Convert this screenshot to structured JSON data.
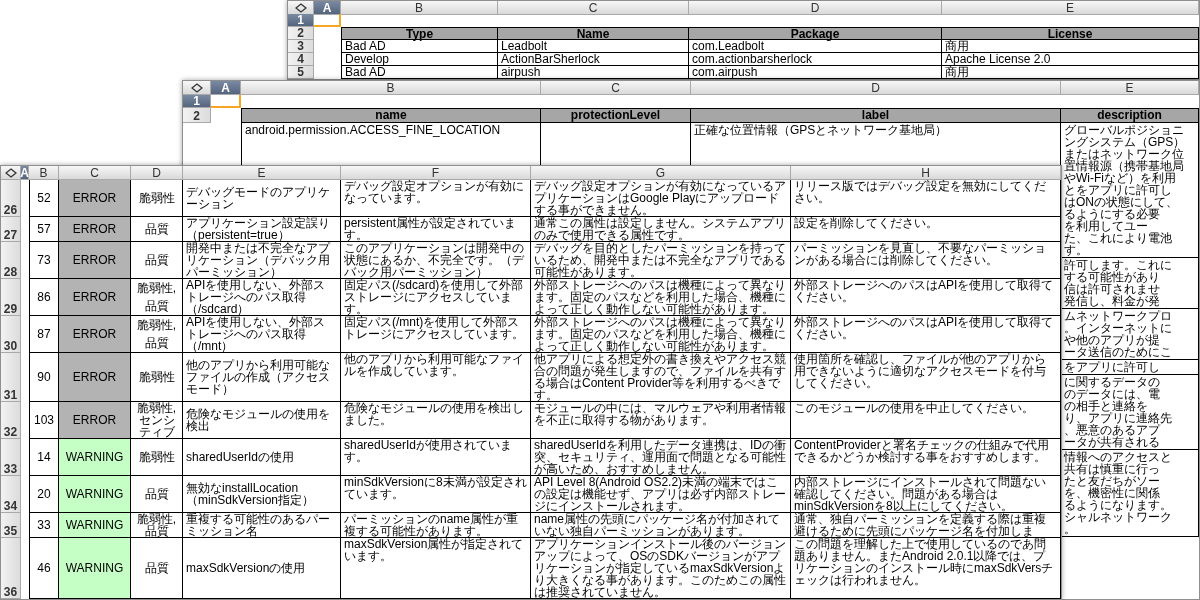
{
  "back_sheet": {
    "columns": [
      {
        "label": "A",
        "selected": true
      },
      {
        "label": "B",
        "selected": false
      },
      {
        "label": "C",
        "selected": false
      },
      {
        "label": "D",
        "selected": false
      },
      {
        "label": "E",
        "selected": false
      }
    ],
    "row_numbers": [
      {
        "label": "1",
        "selected": true
      },
      {
        "label": "2",
        "selected": false
      },
      {
        "label": "3",
        "selected": false
      },
      {
        "label": "4",
        "selected": false
      },
      {
        "label": "5",
        "selected": false
      }
    ],
    "header": [
      "Type",
      "Name",
      "Package",
      "License"
    ],
    "rows": [
      [
        "Bad AD",
        "Leadbolt",
        "com.Leadbolt",
        "商用"
      ],
      [
        "Develop",
        "ActionBarSherlock",
        "com.actionbarsherlock",
        "Apache License 2.0"
      ],
      [
        "Bad AD",
        "airpush",
        "com.airpush",
        "商用"
      ]
    ]
  },
  "middle_sheet": {
    "columns": [
      {
        "label": "A",
        "selected": true
      },
      {
        "label": "B",
        "selected": false
      },
      {
        "label": "C",
        "selected": false
      },
      {
        "label": "D",
        "selected": false
      },
      {
        "label": "E",
        "selected": false
      }
    ],
    "row_numbers": [
      {
        "label": "1",
        "selected": true
      },
      {
        "label": "2",
        "selected": false
      }
    ],
    "header": [
      "name",
      "protectionLevel",
      "label",
      "description"
    ],
    "rows": [
      {
        "column_b": "android.permission.ACCESS_FINE_LOCATION",
        "column_d": "正確な位置情報（GPSとネットワーク基地局）",
        "column_e": [
          "グローバルポジショニングシステム（GPS）またはネットワーク位置情報源（携帯基地局やWi-Fiなど）を利用",
          "とをアプリに許可し",
          "はONの状態にして、",
          "るようにする必要",
          "を利用してユー",
          "た、これにより電池",
          "す。"
        ]
      },
      {
        "column_e": [
          "許可します。これに",
          "する可能性があり",
          "信は許可されませ",
          "発信し、料金が発"
        ]
      },
      {
        "column_e": [
          "ムネットワークプロ",
          "。インターネットに",
          "や他のアプリが提",
          "ータ送信のためにこ"
        ]
      },
      {
        "column_e": [
          "をアプリに許可し"
        ]
      },
      {
        "column_e": [
          "に関するデータの",
          "のデータには、電",
          "の相手と連絡を",
          "り、アプリに連絡先",
          "、悪意のあるアプ",
          "ータが共有される"
        ]
      },
      {
        "column_e": [
          "情報へのアクセスと",
          "共有は慎重に行っ",
          "たと友だちがソー",
          "を、機密性に関係",
          "るようになります。",
          "シャルネットワーク",
          "。"
        ]
      }
    ]
  },
  "front_sheet": {
    "columns": [
      {
        "label": "A",
        "selected": true
      },
      {
        "label": "B",
        "selected": false
      },
      {
        "label": "C",
        "selected": false
      },
      {
        "label": "D",
        "selected": false
      },
      {
        "label": "E",
        "selected": false
      },
      {
        "label": "F",
        "selected": false
      },
      {
        "label": "G",
        "selected": false
      },
      {
        "label": "H",
        "selected": false
      }
    ],
    "rows": [
      {
        "number": "26",
        "column_b": "52",
        "column_c": "ERROR",
        "color": "#b3b3b3",
        "column_d": [
          "脆弱性"
        ],
        "column_e": "デバッグモードのアプリケーション",
        "column_f": "デバッグ設定オプションが有効になっています。",
        "column_g": "デバッグ設定オプションが有効になっているアプリケーションはGoogle Playにアップロードする事ができません。",
        "column_h": "リリース版ではデバッグ設定を無効にしてください。"
      },
      {
        "number": "27",
        "column_b": "57",
        "column_c": "ERROR",
        "color": "#b3b3b3",
        "column_d": [
          "品質"
        ],
        "column_e": "アプリケーション設定誤り（persistent=true）",
        "column_f": "persistent属性が設定されています。",
        "column_g": "通常この属性は設定しません。システムアプリのみで使用できる属性です。",
        "column_h": "設定を削除してください。"
      },
      {
        "number": "28",
        "column_b": "73",
        "column_c": "ERROR",
        "color": "#b3b3b3",
        "column_d": [
          "品質"
        ],
        "column_e": "開発中または不完全なアプリケーション（デバック用パーミッション）",
        "column_f": "このアプリケーションは開発中の状態にあるか、不完全です。（デバック用パーミッション）",
        "column_g": "デバッグを目的としたパーミッションを持っているため、開発中または不完全なアプリである可能性があります。",
        "column_h": "パーミッションを見直し、不要なパーミッションがある場合には削除してください。"
      },
      {
        "number": "29",
        "column_b": "86",
        "column_c": "ERROR",
        "color": "#b3b3b3",
        "column_d": [
          "脆弱性,",
          "品質"
        ],
        "column_e": "APIを使用しない、外部ストレージへのパス取得（/sdcard）",
        "column_f": "固定パス(/sdcard)を使用して外部ストレージにアクセスしています。",
        "column_g": "外部ストレージへのパスは機種によって異なります。固定のパスなどを利用した場合、機種によって正しく動作しない可能性があります。",
        "column_h": "外部ストレージへのパスはAPIを使用して取得てください。"
      },
      {
        "number": "30",
        "column_b": "87",
        "column_c": "ERROR",
        "color": "#b3b3b3",
        "column_d": [
          "脆弱性,",
          "品質"
        ],
        "column_e": "APIを使用しない、外部ストレージへのパス取得（/mnt）",
        "column_f": "固定パス(/mnt)を使用して外部ストレージにアクセスしています。",
        "column_g": "外部ストレージへのパスは機種によって異なります。固定のパスなどを利用した場合、機種によって正しく動作しない可能性があります。",
        "column_h": "外部ストレージへのパスはAPIを使用して取得てください。"
      },
      {
        "number": "31",
        "column_b": "90",
        "column_c": "ERROR",
        "color": "#b3b3b3",
        "column_d": [
          "脆弱性"
        ],
        "column_e": "他のアプリから利用可能なファイルの作成（アクセスモード）",
        "column_f": "他のアプリから利用可能なファイルを作成しています。",
        "column_g": "他アプリによる想定外の書き換えやアクセス競合の問題が発生しますので、ファイルを共有する場合はContent Provider等を利用するべきです。",
        "column_h": "使用箇所を確認し、ファイルが他のアプリから用できないように適切なアクセスモードを付与してください。"
      },
      {
        "number": "32",
        "column_b": "103",
        "column_c": "ERROR",
        "color": "#b3b3b3",
        "column_d": [
          "脆弱性,",
          "センシティブ"
        ],
        "column_e": "危険なモジュールの使用を検出",
        "column_f": "危険なモジュールの使用を検出しました。",
        "column_g": "モジュールの中には、マルウェアや利用者情報を不正に取得する物があります。",
        "column_h": "このモジュールの使用を中止してください。"
      },
      {
        "number": "33",
        "column_b": "14",
        "column_c": "WARNING",
        "color": "#c6ffc6",
        "column_d": [
          "脆弱性"
        ],
        "column_e": "sharedUserIdの使用",
        "column_f": "sharedUserIdが使用されています。",
        "column_g": "sharedUserIdを利用したデータ連携は、IDの衝突、セキュリティ、運用面で問題となる可能性が高いため、おすすめしません。",
        "column_h": "ContentProviderと署名チェックの仕組みで代用できるかどうか検討する事をおすすめします。"
      },
      {
        "number": "34",
        "column_b": "20",
        "column_c": "WARNING",
        "color": "#c6ffc6",
        "column_d": [
          "品質"
        ],
        "column_e": "無効なinstallLocation（minSdkVersion指定）",
        "column_f": "minSdkVersionに8未満が設定されています。",
        "column_g": "API Level 8(Android OS2.2)未満の端末ではこの設定は機能せず、アプリは必ず内部ストレージにインストールされます。",
        "column_h": "内部ストレージにインストールされて問題ない確認してください。問題がある場合はminSdkVersionを8以上にしてください。"
      },
      {
        "number": "35",
        "column_b": "33",
        "column_c": "WARNING",
        "color": "#c6ffc6",
        "column_d": [
          "脆弱性,",
          "品質"
        ],
        "column_e": "重複する可能性のあるパーミッション名",
        "column_f": "パーミッションのname属性が重複する可能性があります。",
        "column_g": "name属性の先頭にパッケージ名が付加されていない独自パーミッションがあります。",
        "column_h": "通常、独自パーミッションを定義する際は重複避けるために先頭にパッケージ名を付加しま"
      },
      {
        "number": "36",
        "column_b": "46",
        "column_c": "WARNING",
        "color": "#c6ffc6",
        "column_d": [
          "品質"
        ],
        "column_e": "maxSdkVersionの使用",
        "column_f": "maxSdkVersion属性が指定されています。",
        "column_g": "アプリケーションインストール後のバージョンアップによって、OSのSDKバージョンがアプリケーションが指定しているmaxSdkVersionより大きくなる事があります。このためこの属性は推奨されていません。",
        "column_h": "この問題を理解した上で使用しているのであ問題ありません。またAndroid 2.0.1以降では、プリケーションのインストール時にmaxSdkVersチェックは行われません。"
      }
    ]
  }
}
